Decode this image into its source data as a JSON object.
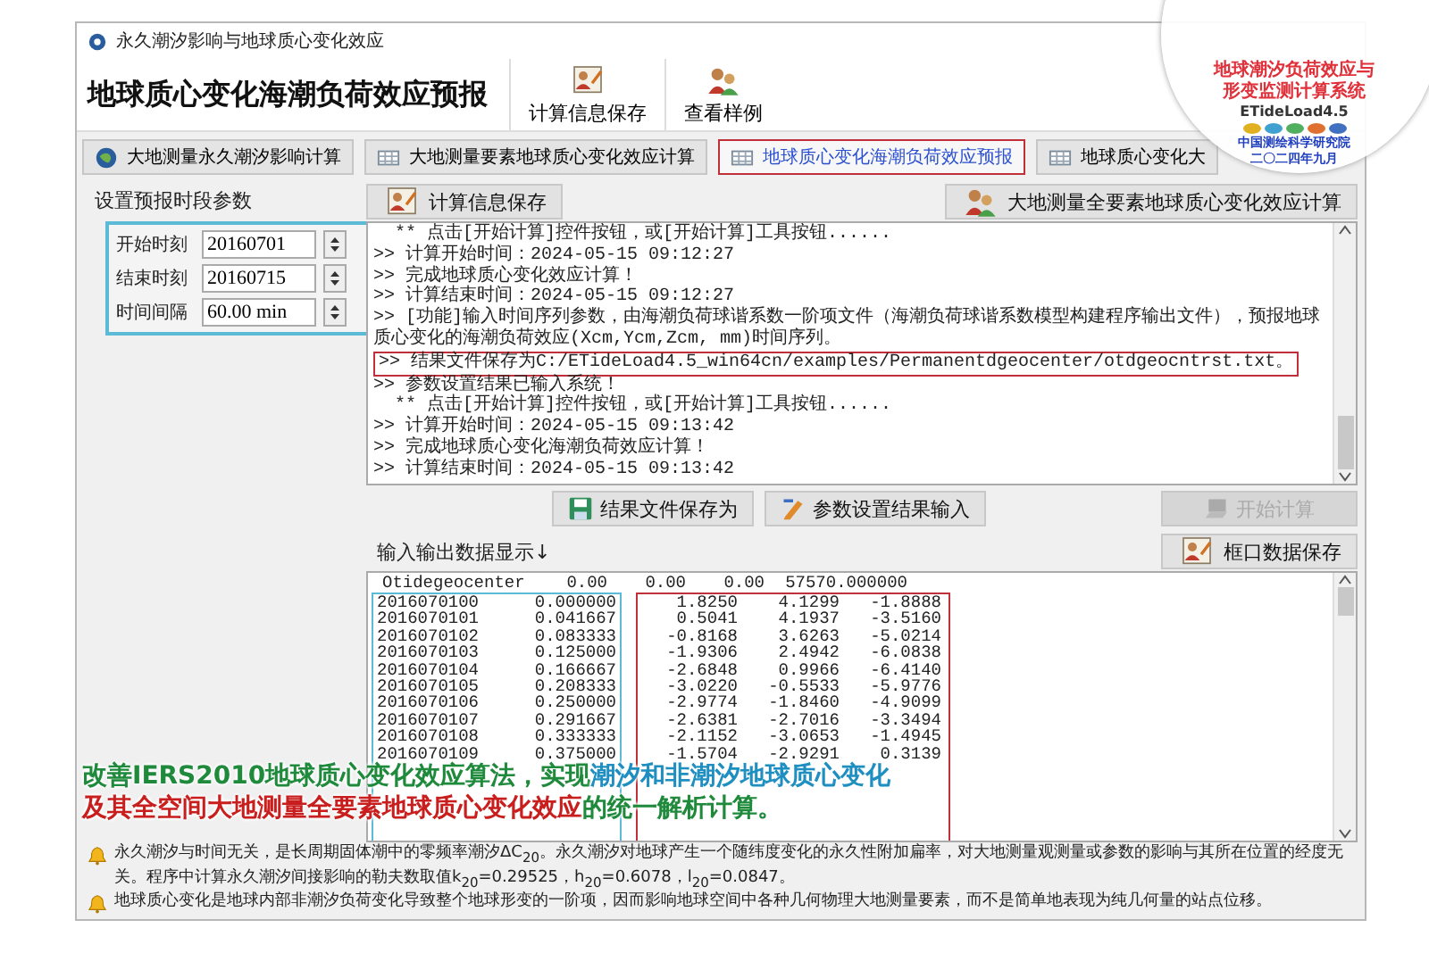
{
  "window": {
    "title": "永久潮汐影响与地球质心变化效应"
  },
  "toolbar": {
    "heading": "地球质心变化海潮负荷效应预报",
    "buttons": [
      {
        "label": "计算信息保存",
        "kind": "save"
      },
      {
        "label": "查看样例",
        "kind": "people"
      }
    ]
  },
  "tabs": [
    {
      "label": "大地测量永久潮汐影响计算",
      "kind": "globe",
      "selected": false
    },
    {
      "label": "大地测量要素地球质心变化效应计算",
      "kind": "grid",
      "selected": false
    },
    {
      "label": "地球质心变化海潮负荷效应预报",
      "kind": "grid",
      "selected": true
    },
    {
      "label": "地球质心变化大",
      "kind": "grid",
      "selected": false
    }
  ],
  "params": {
    "title": "设置预报时段参数",
    "fields": [
      {
        "label": "开始时刻",
        "value": "20160701"
      },
      {
        "label": "结束时刻",
        "value": "20160715"
      },
      {
        "label": "时间间隔",
        "value": "60.00 min"
      }
    ]
  },
  "log_panel": {
    "save_button": "计算信息保存",
    "right_button": "大地测量全要素地球质心变化效应计算",
    "lines": [
      {
        "kind": "hint",
        "text": "** 点击[开始计算]控件按钮，或[开始计算]工具按钮......",
        "highlighted": false
      },
      {
        "kind": "output",
        "text": ">> 计算开始时间：2024-05-15 09:12:27",
        "highlighted": false
      },
      {
        "kind": "output",
        "text": ">> 完成地球质心变化效应计算！",
        "highlighted": false
      },
      {
        "kind": "output",
        "text": ">> 计算结束时间：2024-05-15 09:12:27",
        "highlighted": false
      },
      {
        "kind": "output",
        "text": ">> [功能]输入时间序列参数，由海潮负荷球谐系数一阶项文件（海潮负荷球谐系数模型构建程序输出文件），预报地球质心变化的海潮负荷效应(Xcm,Ycm,Zcm, mm)时间序列。",
        "highlighted": false
      },
      {
        "kind": "output",
        "text": ">> 结果文件保存为C:/ETideLoad4.5_win64cn/examples/Permanentdgeocenter/otdgeocntrst.txt。",
        "highlighted": true
      },
      {
        "kind": "output",
        "text": ">> 参数设置结果已输入系统！",
        "highlighted": false
      },
      {
        "kind": "hint",
        "text": "** 点击[开始计算]控件按钮，或[开始计算]工具按钮......",
        "highlighted": false
      },
      {
        "kind": "output",
        "text": ">> 计算开始时间：2024-05-15 09:13:42",
        "highlighted": false
      },
      {
        "kind": "output",
        "text": ">> 完成地球质心变化海潮负荷效应计算！",
        "highlighted": false
      },
      {
        "kind": "output",
        "text": ">> 计算结束时间：2024-05-15 09:13:42",
        "highlighted": false
      }
    ]
  },
  "actions": [
    {
      "label": "结果文件保存为",
      "kind": "disk",
      "disabled": false
    },
    {
      "label": "参数设置结果输入",
      "kind": "pen",
      "disabled": false
    },
    {
      "label": "开始计算",
      "kind": "run",
      "disabled": true
    }
  ],
  "data_panel": {
    "label": "输入输出数据显示↓",
    "save_button": "框口数据保存",
    "header": [
      "Otidegeocenter",
      "0.00",
      "0.00",
      "0.00",
      "57570.000000"
    ],
    "rows": [
      [
        "2016070100",
        "0.000000",
        "1.8250",
        "4.1299",
        "-1.8888"
      ],
      [
        "2016070101",
        "0.041667",
        "0.5041",
        "4.1937",
        "-3.5160"
      ],
      [
        "2016070102",
        "0.083333",
        "-0.8168",
        "3.6263",
        "-5.0214"
      ],
      [
        "2016070103",
        "0.125000",
        "-1.9306",
        "2.4942",
        "-6.0838"
      ],
      [
        "2016070104",
        "0.166667",
        "-2.6848",
        "0.9966",
        "-6.4140"
      ],
      [
        "2016070105",
        "0.208333",
        "-3.0220",
        "-0.5533",
        "-5.9776"
      ],
      [
        "2016070106",
        "0.250000",
        "-2.9774",
        "-1.8460",
        "-4.9099"
      ],
      [
        "2016070107",
        "0.291667",
        "-2.6381",
        "-2.7016",
        "-3.3494"
      ],
      [
        "2016070108",
        "0.333333",
        "-2.1152",
        "-3.0653",
        "-1.4945"
      ],
      [
        "2016070109",
        "0.375000",
        "-1.5704",
        "-2.9291",
        "0.3139"
      ]
    ]
  },
  "caption": {
    "lines": [
      [
        {
          "text": "改善IERS2010地球质心变化效应算法，实现",
          "color": "#1f8a3c"
        },
        {
          "text": "潮汐和非潮汐地球质心变化",
          "color": "#1e8fc0"
        }
      ],
      [
        {
          "text": "及其全空间大地测量全要素地球质心变化效应",
          "color": "#c81e1e"
        },
        {
          "text": "的统一解析计算。",
          "color": "#1f8a3c"
        }
      ]
    ]
  },
  "notes": [
    "永久潮汐与时间无关，是长周期固体潮中的零频率潮汐ΔC$_{20}$。永久潮汐对地球产生一个随纬度变化的永久性附加扁率，对大地测量观测量或参数的影响与其所在位置的经度无关。程序中计算永久潮汐间接影响的勒夫数取值k$_{20}$=0.29525，h$_{20}$=0.6078，l$_{20}$=0.0847。",
    "地球质心变化是地球内部非潮汐负荷变化导致整个地球形变的一阶项，因而影响地球空间中各种几何物理大地测量要素，而不是简单地表现为纯几何量的站点位移。"
  ],
  "logo": {
    "title_lines": [
      "地球潮汐负荷效应与",
      "形变监测计算系统"
    ],
    "product": "ETideLoad4.5",
    "org": "中国测绘科学研究院",
    "date": "二〇二四年九月"
  }
}
